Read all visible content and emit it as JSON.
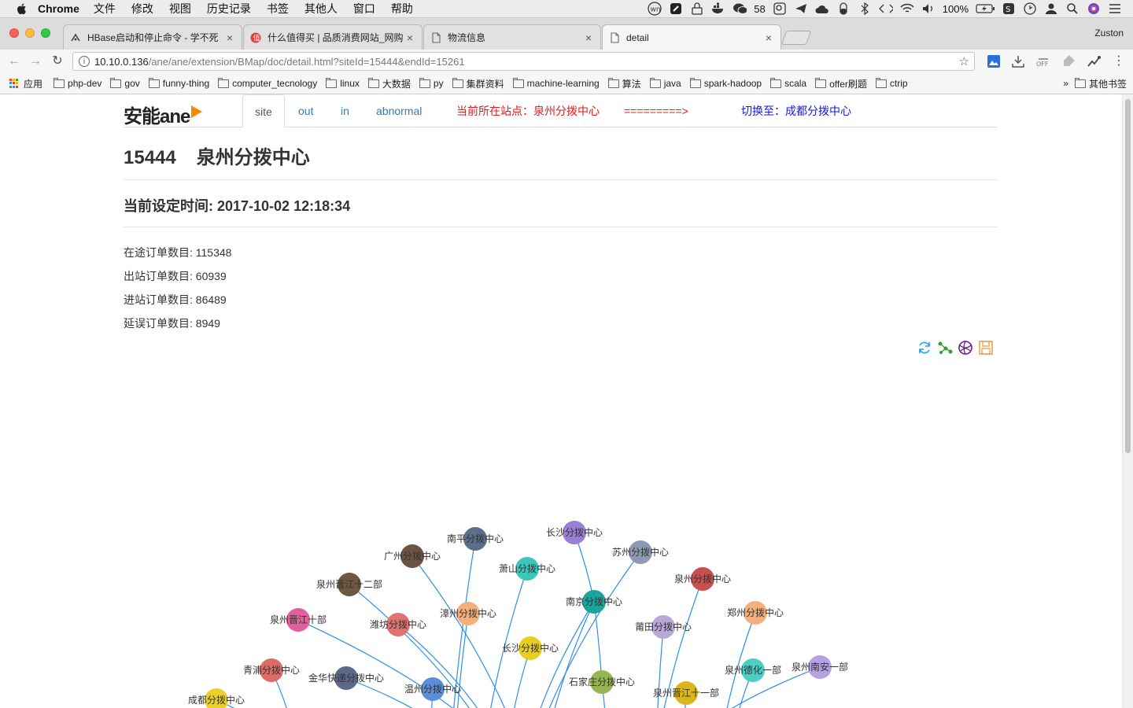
{
  "menubar": {
    "app_name": "Chrome",
    "items": [
      "文件",
      "修改",
      "视图",
      "历史记录",
      "书签",
      "其他人",
      "窗口",
      "帮助"
    ],
    "status": {
      "wechat_count": "58",
      "battery": "100%"
    }
  },
  "browser": {
    "tabs": [
      {
        "title": "HBase启动和停止命令 - 学不死"
      },
      {
        "title": "什么值得买 | 品质消费网站_网购"
      },
      {
        "title": "物流信息"
      },
      {
        "title": "detail"
      }
    ],
    "profile_name": "Zuston",
    "url_host": "10.10.0.136",
    "url_path": "/ane/ane/extension/BMap/doc/detail.html?siteId=15444&endId=15261",
    "bookmarks": [
      "应用",
      "php-dev",
      "gov",
      "funny-thing",
      "computer_tecnology",
      "linux",
      "大数据",
      "py",
      "集群资料",
      "machine-learning",
      "算法",
      "java",
      "spark-hadoop",
      "scala",
      "offer刷题",
      "ctrip"
    ],
    "bookmarks_more": "»",
    "other_bookmarks": "其他书签"
  },
  "page": {
    "logo_text": "安能ane",
    "nav": {
      "tabs": [
        "site",
        "out",
        "in",
        "abnormal"
      ],
      "current_site_label": "当前所在站点：泉州分拨中心",
      "arrow": "=========>",
      "switch_label": "切换至：成都分拨中心"
    },
    "site_id": "15444",
    "site_name": "泉州分拨中心",
    "time_label": "当前设定时间: 2017-10-02 12:18:34",
    "stats": [
      "在途订单数目: 115348",
      "出站订单数目: 60939",
      "进站订单数目: 86489",
      "延误订单数目: 8949"
    ],
    "graph": {
      "nodes": [
        {
          "label": "南平分拨中心",
          "color": "#5b6f8c"
        },
        {
          "label": "长沙分拨中心",
          "color": "#9b7fd4"
        },
        {
          "label": "苏州分拨中心",
          "color": "#8e9ab3"
        },
        {
          "label": "广州分拨中心",
          "color": "#6b5444"
        },
        {
          "label": "萧山分拨中心",
          "color": "#3fc6bb"
        },
        {
          "label": "泉州分拨中心",
          "color": "#c94f4f"
        },
        {
          "label": "泉州晋江十二部",
          "color": "#6e5842"
        },
        {
          "label": "南京分拨中心",
          "color": "#1ba39c"
        },
        {
          "label": "郑州分拨中心",
          "color": "#f4b07c"
        },
        {
          "label": "泉州晋江十部",
          "color": "#e2609b"
        },
        {
          "label": "漳州分拨中心",
          "color": "#f5b07a"
        },
        {
          "label": "潍坊分拨中心",
          "color": "#e0736f"
        },
        {
          "label": "莆田分拨中心",
          "color": "#b8a8d6"
        },
        {
          "label": "长沙分拨中心",
          "color": "#e8cf1f"
        },
        {
          "label": "泉州南安一部",
          "color": "#b6a2e2"
        },
        {
          "label": "青浦分拨中心",
          "color": "#dd6b66"
        },
        {
          "label": "泉州德化一部",
          "color": "#4ecdc4"
        },
        {
          "label": "金华快递分拨中心",
          "color": "#5d6789"
        },
        {
          "label": "石家庄分拨中心",
          "color": "#97b552"
        },
        {
          "label": "温州分拨中心",
          "color": "#5b8ed8"
        },
        {
          "label": "泉州晋江十一部",
          "color": "#d9b61c"
        },
        {
          "label": "成都分拨中心",
          "color": "#ead028"
        }
      ],
      "link_color": "#2f8fe8"
    }
  }
}
